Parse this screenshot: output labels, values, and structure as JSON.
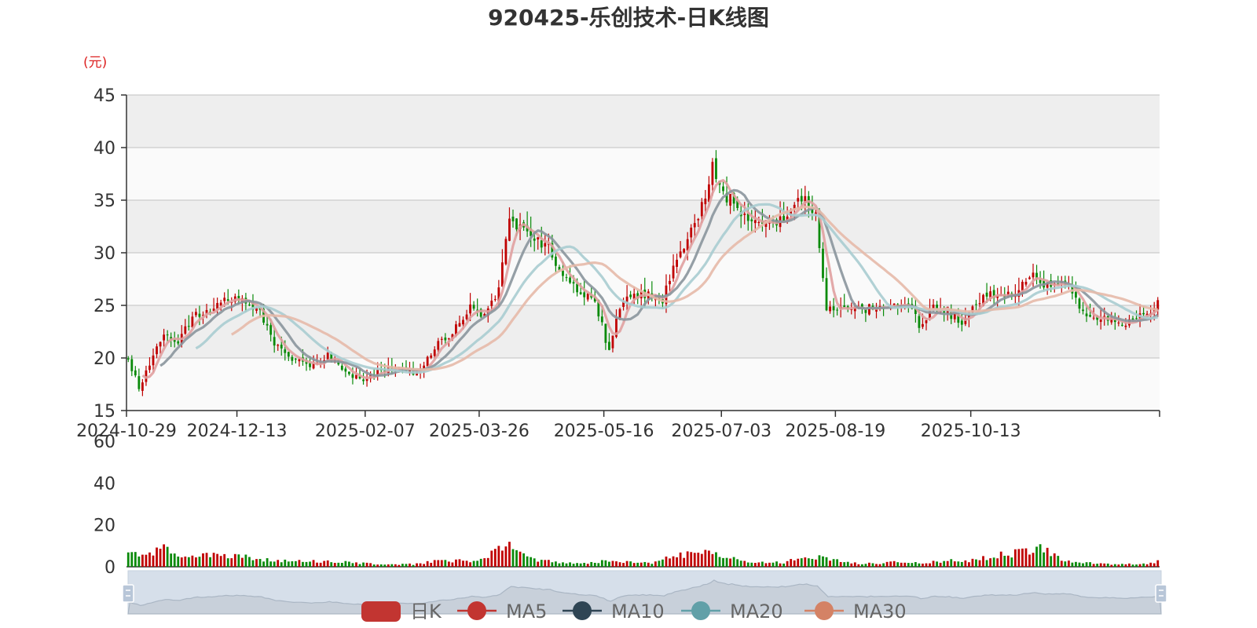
{
  "chart_data": {
    "type": "candlestick",
    "title": "920425-乐创技术-日K线图",
    "price_unit": "(元)",
    "price_ylim": [
      15,
      45
    ],
    "price_yticks": [
      15,
      20,
      25,
      30,
      35,
      40,
      45
    ],
    "volume_ylim": [
      0,
      60
    ],
    "volume_yticks": [
      0,
      20,
      40,
      60
    ],
    "x_ticks": [
      "2024-10-29",
      "2024-12-13",
      "2025-02-07",
      "2025-03-26",
      "2025-05-16",
      "2025-07-03",
      "2025-08-19",
      "2025-10-13"
    ],
    "x_range": [
      "2024-10-29",
      "2025-10-31"
    ],
    "grid": true,
    "up_color": "#c00000",
    "down_color": "#0a8a0a",
    "legend": [
      {
        "name": "日K",
        "color": "#c23531"
      },
      {
        "name": "MA5",
        "color": "#c23531"
      },
      {
        "name": "MA10",
        "color": "#2f4554"
      },
      {
        "name": "MA20",
        "color": "#61a0a8"
      },
      {
        "name": "MA30",
        "color": "#d48265"
      }
    ],
    "legend_position": "bottom-center",
    "datazoom": {
      "start": 0,
      "end": 100
    },
    "close_anchors": [
      [
        0,
        20.0
      ],
      [
        3,
        17.2
      ],
      [
        6,
        19.5
      ],
      [
        10,
        22.3
      ],
      [
        14,
        21.5
      ],
      [
        18,
        24.0
      ],
      [
        23,
        24.5
      ],
      [
        28,
        25.8
      ],
      [
        33,
        25.5
      ],
      [
        37,
        24.2
      ],
      [
        41,
        21.5
      ],
      [
        46,
        20.0
      ],
      [
        51,
        19.3
      ],
      [
        56,
        20.3
      ],
      [
        61,
        18.8
      ],
      [
        66,
        17.8
      ],
      [
        71,
        18.9
      ],
      [
        76,
        19.0
      ],
      [
        81,
        18.5
      ],
      [
        86,
        21.0
      ],
      [
        91,
        22.5
      ],
      [
        96,
        24.8
      ],
      [
        100,
        24.0
      ],
      [
        104,
        26.5
      ],
      [
        107,
        33.0
      ],
      [
        110,
        32.5
      ],
      [
        114,
        31.5
      ],
      [
        118,
        30.5
      ],
      [
        122,
        27.5
      ],
      [
        127,
        26.2
      ],
      [
        131,
        25.5
      ],
      [
        135,
        20.5
      ],
      [
        138,
        25.0
      ],
      [
        142,
        25.8
      ],
      [
        146,
        26.2
      ],
      [
        150,
        25.5
      ],
      [
        154,
        29.5
      ],
      [
        158,
        32.0
      ],
      [
        162,
        35.5
      ],
      [
        164,
        38.0
      ],
      [
        166,
        36.0
      ],
      [
        169,
        35.0
      ],
      [
        173,
        33.5
      ],
      [
        177,
        32.8
      ],
      [
        181,
        33.2
      ],
      [
        185,
        33.0
      ],
      [
        188,
        35.5
      ],
      [
        191,
        34.5
      ],
      [
        193,
        33.5
      ],
      [
        196,
        24.5
      ],
      [
        199,
        25.0
      ],
      [
        203,
        24.5
      ],
      [
        208,
        24.7
      ],
      [
        213,
        24.5
      ],
      [
        218,
        25.5
      ],
      [
        222,
        23.2
      ],
      [
        226,
        24.8
      ],
      [
        230,
        24.5
      ],
      [
        234,
        23.0
      ],
      [
        238,
        25.0
      ],
      [
        242,
        26.2
      ],
      [
        246,
        25.8
      ],
      [
        250,
        26.5
      ],
      [
        253,
        28.0
      ],
      [
        256,
        27.0
      ],
      [
        260,
        27.2
      ],
      [
        264,
        26.8
      ],
      [
        268,
        24.5
      ],
      [
        272,
        23.8
      ],
      [
        276,
        23.5
      ],
      [
        280,
        23.3
      ],
      [
        284,
        24.2
      ],
      [
        287,
        24.5
      ],
      [
        289,
        25.3
      ]
    ],
    "volume_anchors": [
      [
        0,
        7
      ],
      [
        5,
        6
      ],
      [
        10,
        9
      ],
      [
        14,
        6
      ],
      [
        19,
        6
      ],
      [
        24,
        6
      ],
      [
        28,
        5
      ],
      [
        33,
        5
      ],
      [
        38,
        3.5
      ],
      [
        44,
        3
      ],
      [
        50,
        2.5
      ],
      [
        56,
        2.8
      ],
      [
        62,
        2
      ],
      [
        68,
        1.5
      ],
      [
        75,
        1.2
      ],
      [
        80,
        1.2
      ],
      [
        86,
        2.5
      ],
      [
        92,
        3
      ],
      [
        98,
        2.5
      ],
      [
        103,
        7
      ],
      [
        106,
        11
      ],
      [
        110,
        6
      ],
      [
        115,
        3
      ],
      [
        122,
        2
      ],
      [
        130,
        2
      ],
      [
        136,
        3
      ],
      [
        142,
        2
      ],
      [
        148,
        2
      ],
      [
        153,
        5
      ],
      [
        158,
        6
      ],
      [
        163,
        9
      ],
      [
        167,
        5
      ],
      [
        172,
        3
      ],
      [
        178,
        2
      ],
      [
        184,
        2
      ],
      [
        188,
        4
      ],
      [
        192,
        3
      ],
      [
        195,
        5
      ],
      [
        198,
        3
      ],
      [
        205,
        1.5
      ],
      [
        212,
        1.8
      ],
      [
        218,
        2.5
      ],
      [
        225,
        2
      ],
      [
        230,
        3
      ],
      [
        235,
        2.5
      ],
      [
        240,
        4
      ],
      [
        246,
        6
      ],
      [
        252,
        7
      ],
      [
        256,
        9
      ],
      [
        260,
        5
      ],
      [
        264,
        2.5
      ],
      [
        270,
        1.8
      ],
      [
        276,
        1.2
      ],
      [
        282,
        1.2
      ],
      [
        286,
        1.5
      ],
      [
        289,
        2.5
      ]
    ]
  }
}
